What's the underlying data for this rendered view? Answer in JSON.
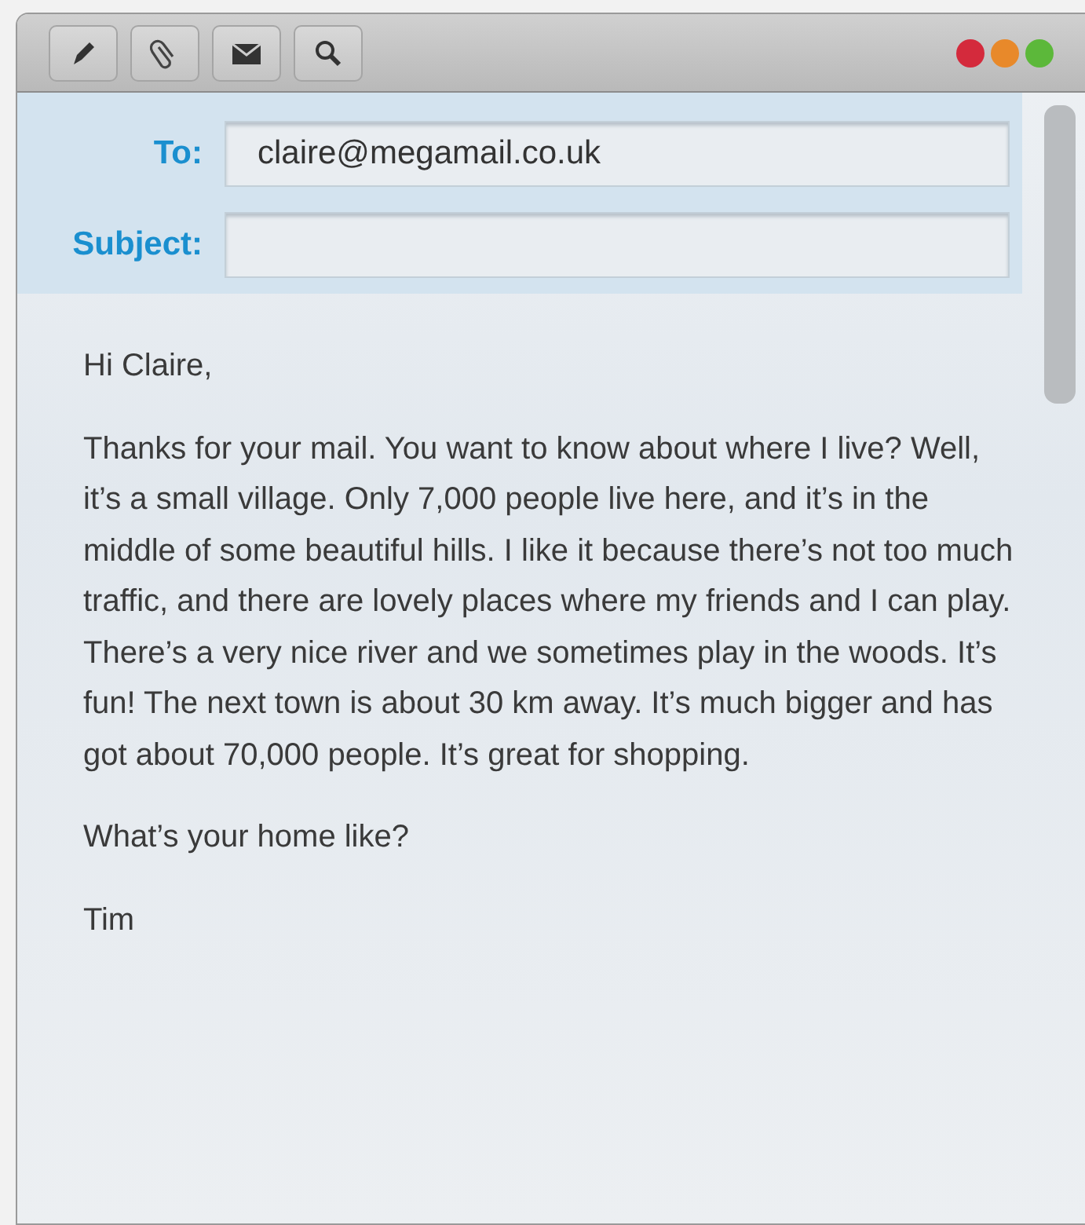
{
  "toolbar": {
    "tools": [
      {
        "kind": "pencil"
      },
      {
        "kind": "paperclip"
      },
      {
        "kind": "envelope"
      },
      {
        "kind": "search"
      }
    ],
    "window_controls": [
      {
        "color": "#d42a3c"
      },
      {
        "color": "#e8892a"
      },
      {
        "color": "#5cb83a"
      }
    ]
  },
  "header": {
    "fields": [
      {
        "label": "To:",
        "value": "claire@megamail.co.uk"
      },
      {
        "label": "Subject:"
      }
    ]
  },
  "message": {
    "paragraphs": [
      "Hi Claire,",
      "Thanks for your mail. You want to know about where I live? Well, it’s a small village. Only 7,000 people live here, and it’s in the middle of some beautiful hills. I like it because there’s not too much traffic, and there are lovely places where my friends and I can play. There’s a very nice river and we sometimes play in the woods. It’s fun! The next town is about 30 km away. It’s much bigger and has got about 70,000 people. It’s great for shopping.",
      "What’s your home like?",
      "Tim"
    ]
  }
}
